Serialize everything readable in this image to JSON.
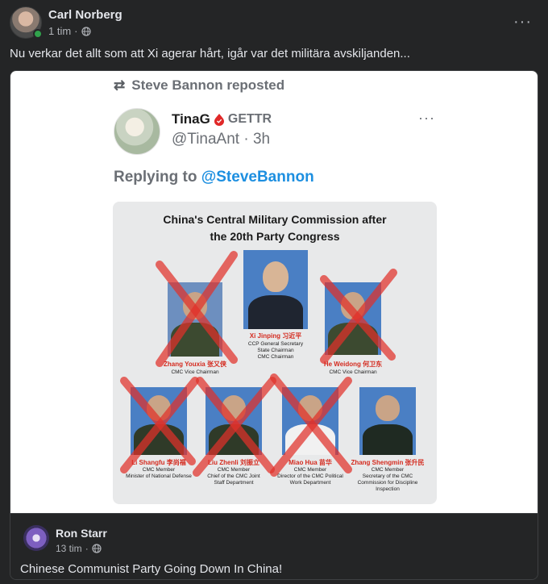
{
  "post": {
    "author": "Carl Norberg",
    "time": "1 tim",
    "separator": "·",
    "more": "···",
    "text": "Nu verkar det allt som att Xi agerar hårt, igår var det militära avskiljanden..."
  },
  "shared": {
    "repost_text": "Steve Bannon reposted",
    "repost_icon": "⇄",
    "name": "TinaG",
    "platform": "GETTR",
    "handle": "@TinaAnt · 3h",
    "more": "···",
    "replying_prefix": "Replying to ",
    "replying_mention": "@SteveBannon",
    "graphic": {
      "title_line1": "China's Central Military Commission after",
      "title_line2": "the 20th Party Congress",
      "members": [
        {
          "name": "Xi Jinping 习近平",
          "title": "CCP General Secretary\nState Chairman\nCMC Chairman",
          "crossed": false
        },
        {
          "name": "Zhang Youxia 张又侠",
          "title": "CMC Vice Chairman",
          "crossed": true
        },
        {
          "name": "He Weidong 何卫东",
          "title": "CMC Vice Chairman",
          "crossed": true
        },
        {
          "name": "Li Shangfu 李尚福",
          "title": "CMC Member\nMinister of National Defense",
          "crossed": true
        },
        {
          "name": "Liu Zhenli 刘振立",
          "title": "CMC Member\nChief of the CMC Joint\nStaff Department",
          "crossed": true
        },
        {
          "name": "Miao Hua 苗华",
          "title": "CMC Member\nDirector of the CMC Political\nWork Department",
          "crossed": true
        },
        {
          "name": "Zhang Shengmin 张升民",
          "title": "CMC Member\nSecretary of the CMC\nCommission for Discipline\nInspection",
          "crossed": false
        }
      ]
    }
  },
  "comment": {
    "author": "Ron Starr",
    "time": "13 tim",
    "separator": "·",
    "text": "Chinese Communist Party Going Down In China!"
  }
}
